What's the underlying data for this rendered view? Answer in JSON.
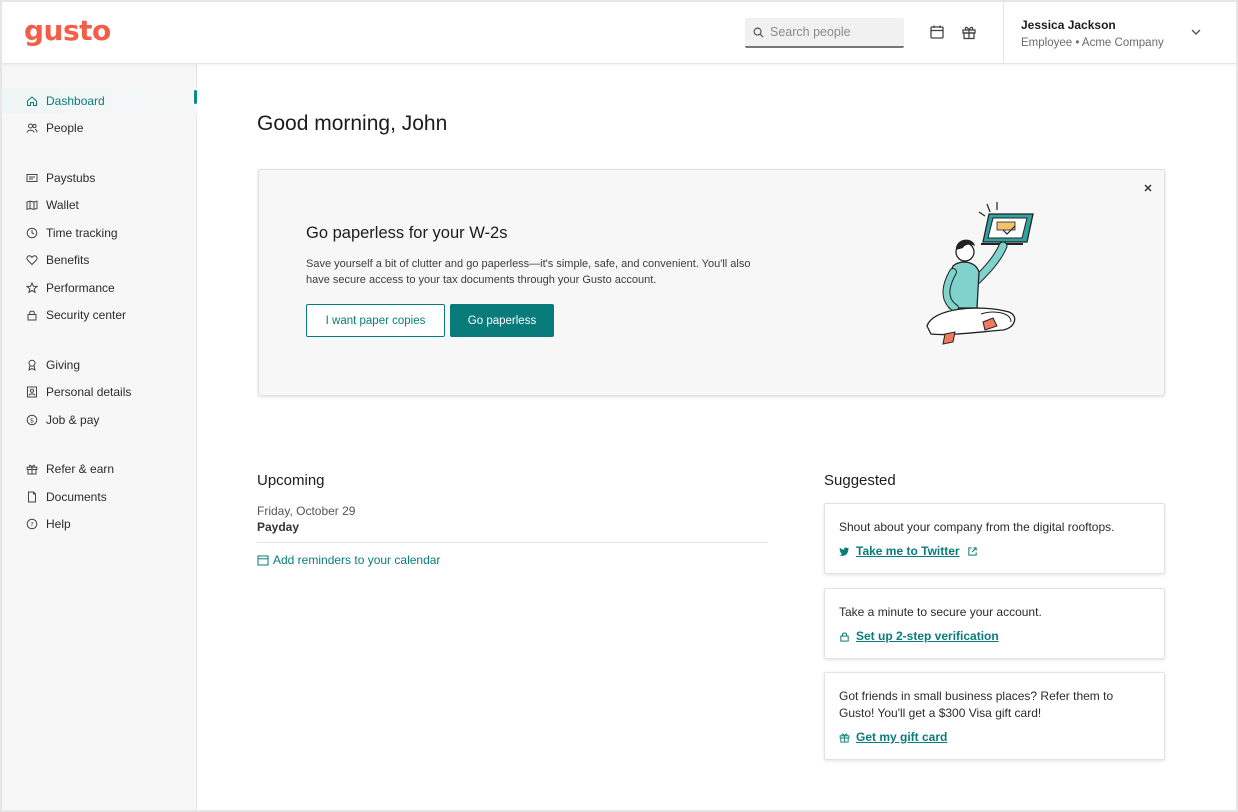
{
  "header": {
    "logo": "gusto",
    "search_placeholder": "Search people",
    "user": {
      "name": "Jessica Jackson",
      "subtitle": "Employee • Acme Company"
    },
    "icons": [
      "calendar-icon",
      "gift-icon",
      "chevron-down-icon"
    ]
  },
  "sidebar": {
    "items": [
      {
        "label": "Dashboard",
        "icon": "home-icon",
        "active": true
      },
      {
        "label": "People",
        "icon": "people-icon"
      },
      {
        "label": "Paystubs",
        "icon": "paystub-icon"
      },
      {
        "label": "Wallet",
        "icon": "wallet-icon"
      },
      {
        "label": "Time tracking",
        "icon": "clock-icon"
      },
      {
        "label": "Benefits",
        "icon": "heart-icon"
      },
      {
        "label": "Performance",
        "icon": "star-icon"
      },
      {
        "label": "Security center",
        "icon": "lock-icon"
      },
      {
        "label": "Giving",
        "icon": "ribbon-icon"
      },
      {
        "label": "Personal details",
        "icon": "id-card-icon"
      },
      {
        "label": "Job & pay",
        "icon": "dollar-icon"
      },
      {
        "label": "Refer & earn",
        "icon": "gift-icon"
      },
      {
        "label": "Documents",
        "icon": "document-icon"
      },
      {
        "label": "Help",
        "icon": "help-icon"
      }
    ]
  },
  "main": {
    "greeting": "Good morning, John",
    "banner": {
      "title": "Go paperless for your W-2s",
      "body": "Save yourself a bit of clutter and go paperless—it's simple, safe, and convenient. You'll also have secure access to your tax documents through your Gusto account.",
      "secondary_button": "I want paper copies",
      "primary_button": "Go paperless"
    },
    "upcoming": {
      "title": "Upcoming",
      "date": "Friday, October 29",
      "event": "Payday",
      "calendar_link": "Add reminders to your calendar"
    },
    "suggested": {
      "title": "Suggested",
      "cards": [
        {
          "text": "Shout about your company from the digital rooftops.",
          "link": "Take me to Twitter",
          "icon": "twitter-icon"
        },
        {
          "text": "Take a minute to secure your account.",
          "link": "Set up 2-step verification",
          "icon": "lock-icon"
        },
        {
          "text": "Got friends in small business places? Refer them to Gusto! You'll get a $300 Visa gift card!",
          "link": "Get my gift card",
          "icon": "gift-icon"
        }
      ]
    }
  },
  "colors": {
    "brand": "#f45d48",
    "accent": "#0a7b7b",
    "sidebar_bg": "#f7f7f7"
  }
}
